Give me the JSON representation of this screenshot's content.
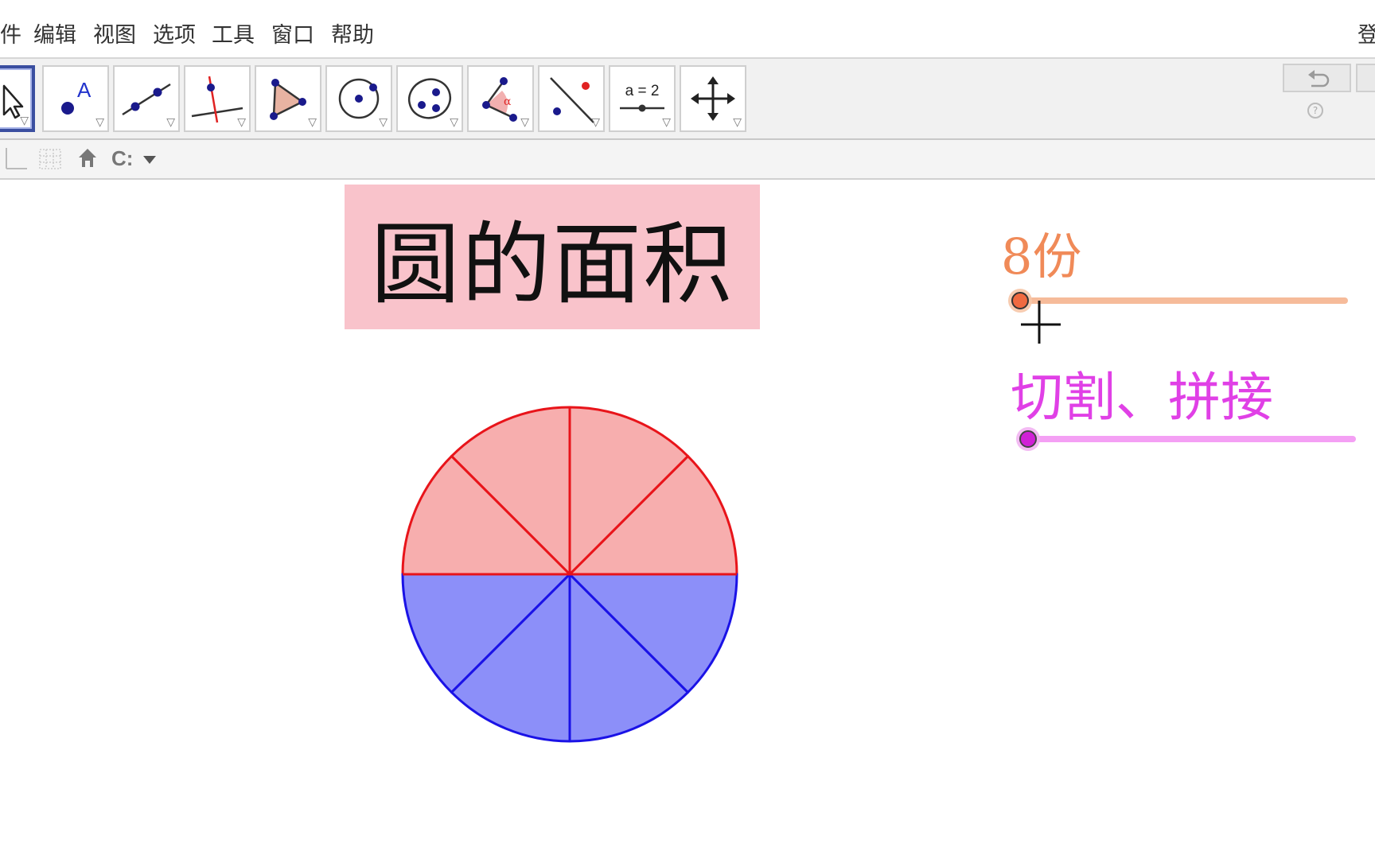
{
  "menu": {
    "items": [
      "件",
      "编辑",
      "视图",
      "选项",
      "工具",
      "窗口",
      "帮助"
    ],
    "login": "登"
  },
  "toolbar": {
    "tools": [
      {
        "name": "move-tool",
        "icon": "arrow-cursor-icon",
        "selected": true
      },
      {
        "name": "point-tool",
        "icon": "point-icon",
        "label": "A"
      },
      {
        "name": "line-tool",
        "icon": "line-icon"
      },
      {
        "name": "perpendicular-tool",
        "icon": "perpendicular-icon"
      },
      {
        "name": "polygon-tool",
        "icon": "polygon-icon"
      },
      {
        "name": "circle-tool",
        "icon": "circle-center-icon"
      },
      {
        "name": "ellipse-tool",
        "icon": "ellipse-icon"
      },
      {
        "name": "angle-tool",
        "icon": "angle-icon",
        "label": "α"
      },
      {
        "name": "reflect-tool",
        "icon": "reflect-icon"
      },
      {
        "name": "slider-tool",
        "icon": "slider-icon",
        "label": "a = 2"
      },
      {
        "name": "move-view-tool",
        "icon": "move-view-icon"
      }
    ],
    "undo_icon": "undo-icon",
    "help_icon": "help-icon",
    "help_glyph": "?"
  },
  "stylebar": {
    "axes_icon": "axes-icon",
    "grid_icon": "grid-icon",
    "home_icon": "home-icon",
    "point_capture_label": "C:"
  },
  "graphics": {
    "title": "圆的面积",
    "slider1": {
      "label": "8份",
      "value_fraction": 0.0,
      "color": "#f08a58"
    },
    "slider2": {
      "label": "切割、拼接",
      "value_fraction": 0.0,
      "color": "#e040e6"
    },
    "circle": {
      "sectors": 8,
      "top_fill": "#f7aeae",
      "top_stroke": "#e8141a",
      "bottom_fill": "#8c8ff9",
      "bottom_stroke": "#1a12e6"
    }
  },
  "colors": {
    "title_bg": "#f9c3cb",
    "selected_tool_border": "#3b4fa0"
  }
}
